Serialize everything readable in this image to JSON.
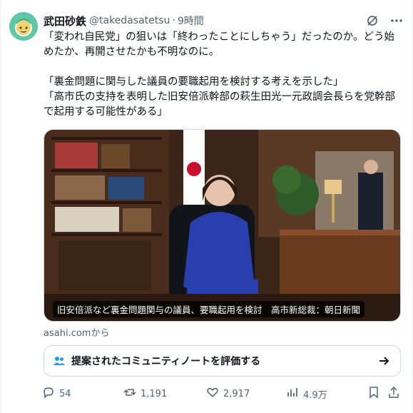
{
  "author": {
    "name": "武田砂鉄",
    "handle": "@takedasatetsu",
    "separator": "·",
    "time": "9時間"
  },
  "post": {
    "line1": "「変われ自民党」の狙いは「終わったことにしちゃう」だったのか。どう始",
    "line2": "めたか、再開させたかも不明なのに。",
    "quote1": "「裏金問題に関与した議員の要職起用を検討する考えを示した」",
    "quote2": "「高市氏の支持を表明した旧安倍派幹部の萩生田光一元政調会長らを党幹部",
    "quote3": "で起用する可能性がある」"
  },
  "media": {
    "caption": "旧安倍派など裏金問題関与の議員、要職起用を検討　高市新総裁：朝日新聞",
    "source": "asahi.comから"
  },
  "community_note": {
    "label": "提案されたコミュニティノートを評価する"
  },
  "actions": {
    "replies": "54",
    "reposts": "1,191",
    "likes": "2,917",
    "views": "4.9万"
  },
  "colors": {
    "text": "#0f1419",
    "muted": "#536471",
    "border": "#cfd9de",
    "avatar_bg": "#5fc8a7"
  },
  "icons": [
    "grok-icon",
    "more-icon",
    "people-icon",
    "arrow-right-icon",
    "reply-icon",
    "repost-icon",
    "like-icon",
    "views-icon",
    "bookmark-icon",
    "share-icon"
  ]
}
